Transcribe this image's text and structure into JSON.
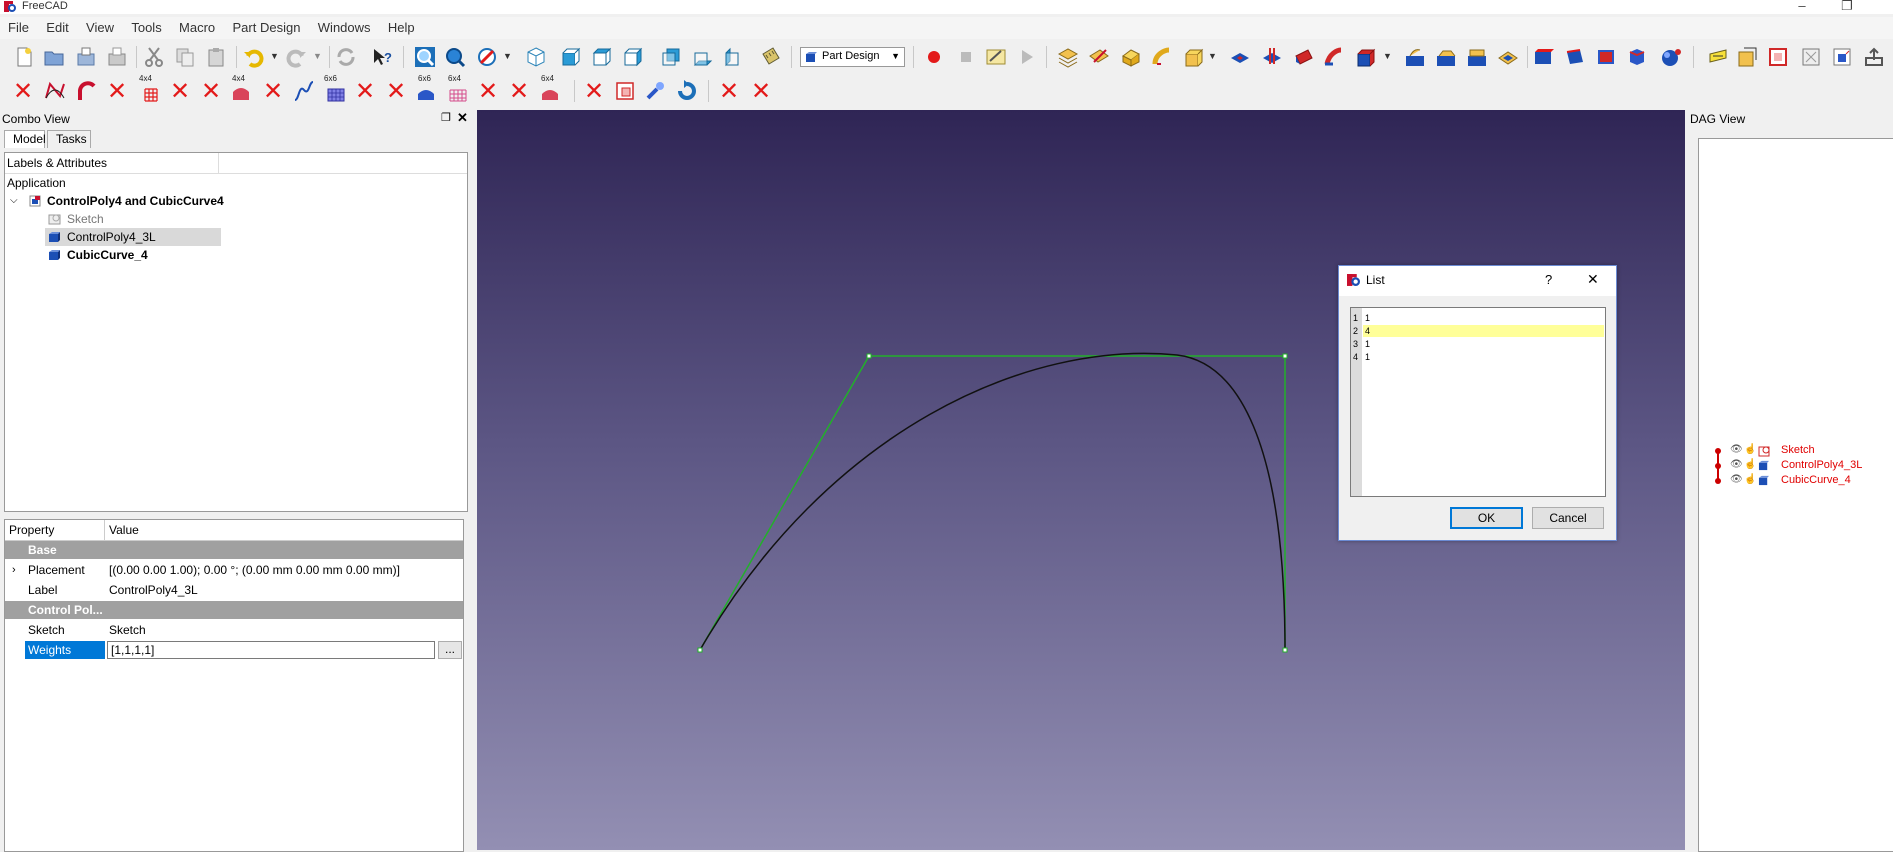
{
  "app": {
    "title": "FreeCAD"
  },
  "menu": [
    "File",
    "Edit",
    "View",
    "Tools",
    "Macro",
    "Part Design",
    "Windows",
    "Help"
  ],
  "toolbar": {
    "workbench": "Part Design"
  },
  "toolbar2": {
    "labels": [
      "4x4",
      "4x4",
      "6x6",
      "6x6",
      "6x4",
      "6x4"
    ]
  },
  "combo": {
    "title": "Combo View",
    "tabs": [
      "Model",
      "Tasks"
    ],
    "tree": {
      "header": "Labels & Attributes",
      "application": "Application",
      "document": "ControlPoly4 and CubicCurve4",
      "items": [
        "Sketch",
        "ControlPoly4_3L",
        "CubicCurve_4"
      ]
    },
    "props": {
      "col_property": "Property",
      "col_value": "Value",
      "group_base": "Base",
      "placement_label": "Placement",
      "placement_value": "[(0.00 0.00 1.00); 0.00 °; (0.00 mm  0.00 mm  0.00 mm)]",
      "label_label": "Label",
      "label_value": "ControlPoly4_3L",
      "group_control": "Control Pol...",
      "sketch_label": "Sketch",
      "sketch_value": "Sketch",
      "weights_label": "Weights",
      "weights_value": "[1,1,1,1]",
      "ellipsis": "..."
    }
  },
  "dialog": {
    "title": "List",
    "help": "?",
    "close": "✕",
    "line_numbers": [
      "1",
      "2",
      "3",
      "4"
    ],
    "lines": [
      "1",
      "4",
      "1",
      "1"
    ],
    "ok": "OK",
    "cancel": "Cancel"
  },
  "dag": {
    "title": "DAG View",
    "nodes": [
      "Sketch",
      "ControlPoly4_3L",
      "CubicCurve_4"
    ]
  },
  "colors": {
    "accent_blue": "#0078d7",
    "polygon_green": "#22b02a",
    "dag_red": "#e00000",
    "highlight_yellow": "#ffff99"
  }
}
